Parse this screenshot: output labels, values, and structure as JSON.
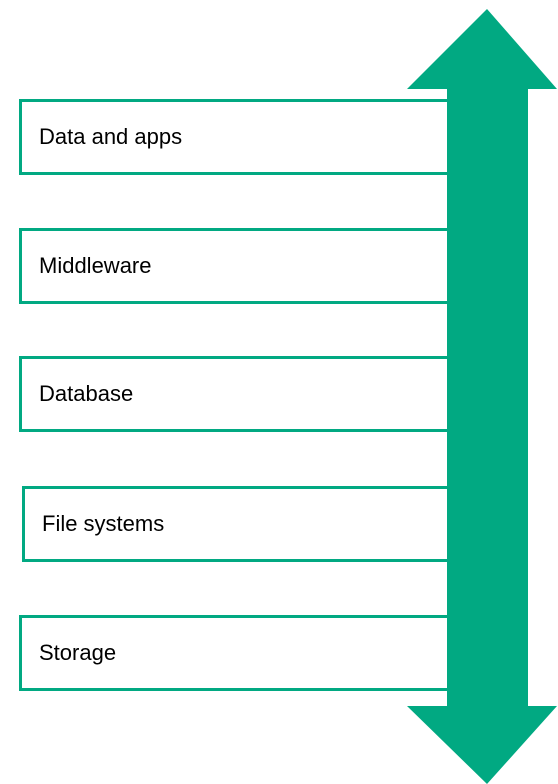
{
  "colors": {
    "accent": "#01a982",
    "text": "#000000",
    "background": "#ffffff"
  },
  "arrow": {
    "icon": "double-headed-vertical-arrow-icon"
  },
  "layers": [
    {
      "label": "Data and apps"
    },
    {
      "label": "Middleware"
    },
    {
      "label": "Database"
    },
    {
      "label": "File systems"
    },
    {
      "label": "Storage"
    }
  ]
}
